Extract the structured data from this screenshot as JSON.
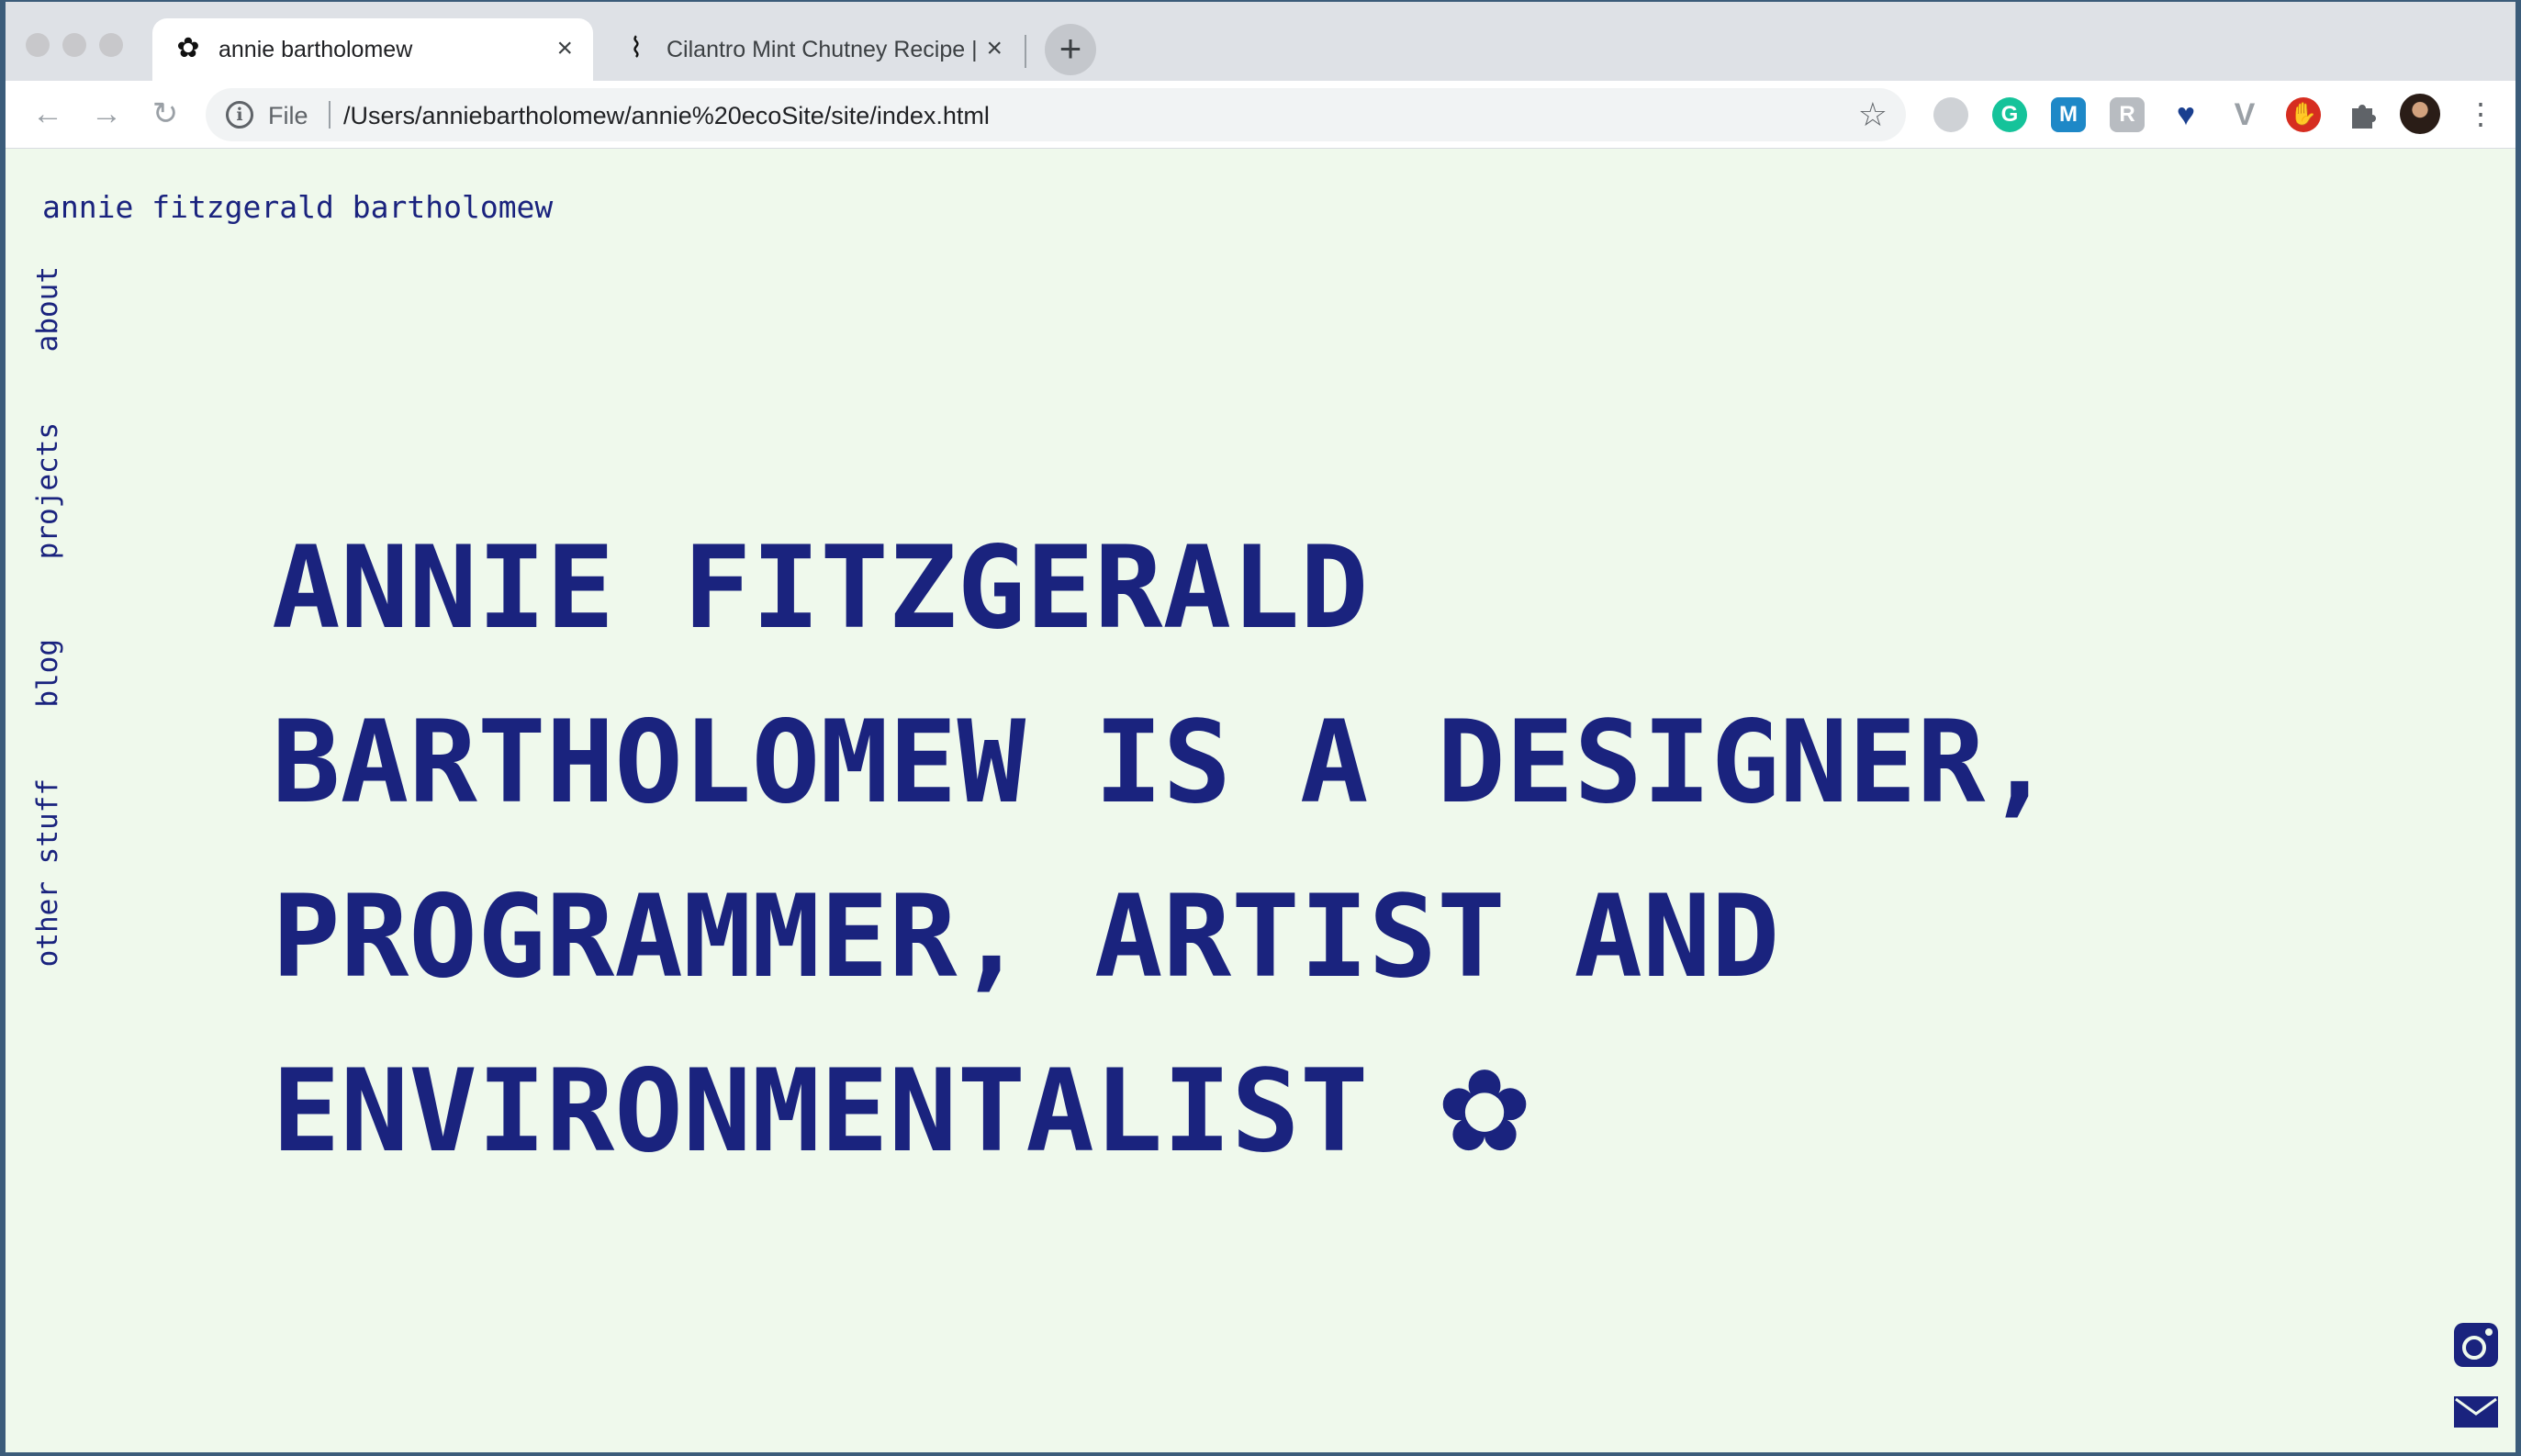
{
  "browser": {
    "tabs": [
      {
        "icon": "✿",
        "title": "annie bartholomew",
        "close": "×"
      },
      {
        "icon": "⌇",
        "title": "Cilantro Mint Chutney Recipe |",
        "close": "×"
      }
    ],
    "new_tab": "+",
    "nav": {
      "back": "←",
      "forward": "→",
      "reload": "↻"
    },
    "address": {
      "info": "i",
      "scheme": "File",
      "url": "/Users/anniebartholomew/annie%20ecoSite/site/index.html",
      "bookmark": "☆"
    },
    "extensions": [
      "reader-extension-icon",
      "grammarly-icon",
      "m-extension-icon",
      "r-extension-icon",
      "heart-extension-icon",
      "v-extension-icon",
      "stop-extension-icon",
      "puzzle-extensions-icon"
    ],
    "menu": "⋮"
  },
  "page": {
    "site_name": "annie fitzgerald bartholomew",
    "nav": [
      "about",
      "projects",
      "blog",
      "other stuff"
    ],
    "hero_lines": [
      "ANNIE FITZGERALD",
      "BARTHOLOMEW IS A DESIGNER,",
      "PROGRAMMER, ARTIST AND",
      "ENVIRONMENTALIST"
    ],
    "hero_flower": "✿",
    "social": [
      "instagram-icon",
      "mail-icon"
    ]
  },
  "colors": {
    "page_bg": "#eff9ec",
    "ink": "#1a237e"
  }
}
